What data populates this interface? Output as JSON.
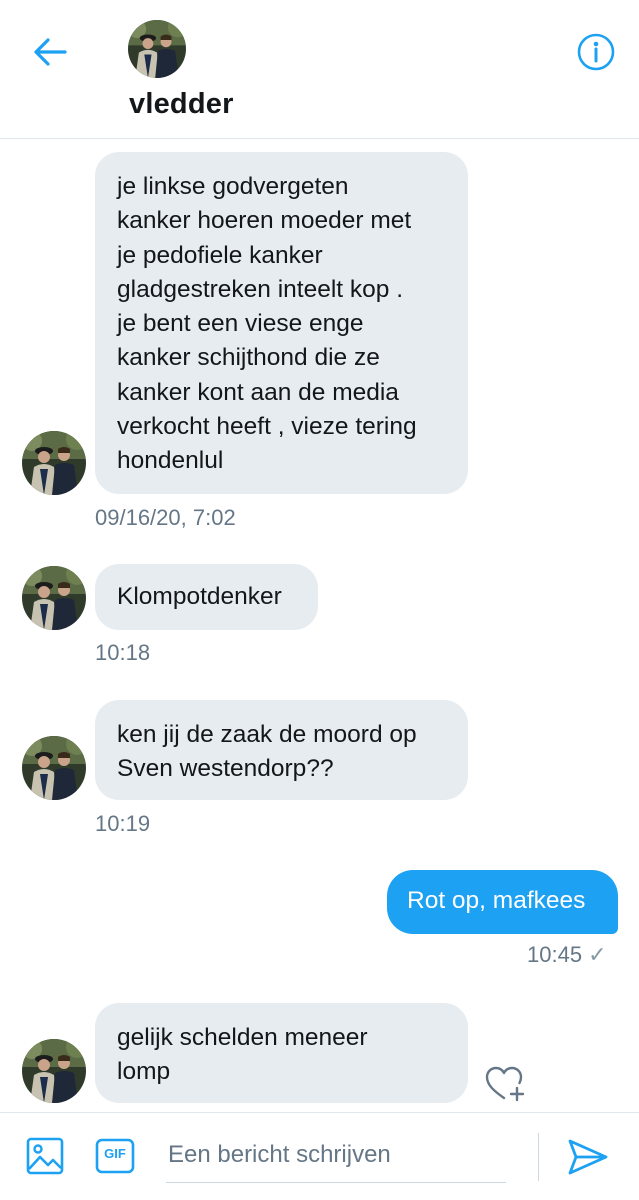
{
  "header": {
    "username": "vledder"
  },
  "messages": [
    {
      "direction": "incoming",
      "text": "je linkse godvergeten\nkanker hoeren moeder met\nje pedofiele kanker\ngladgestreken inteelt kop .\nje bent een viese enge\nkanker schijthond die ze\nkanker kont aan de media\nverkocht heeft , vieze tering\nhondenlul",
      "time": "09/16/20, 7:02"
    },
    {
      "direction": "incoming",
      "text": "Klompotdenker",
      "time": "10:18"
    },
    {
      "direction": "incoming",
      "text": "ken jij de zaak de moord op\nSven westendorp??",
      "time": "10:19"
    },
    {
      "direction": "outgoing",
      "text": "Rot op, mafkees",
      "time": "10:45",
      "status": "✓"
    },
    {
      "direction": "incoming",
      "text": "gelijk schelden meneer\nlomp",
      "time": ""
    }
  ],
  "composer": {
    "placeholder": "Een bericht schrijven",
    "gif_label": "GIF"
  },
  "colors": {
    "accent": "#1da1f2",
    "incoming_bubble": "#e6ecf0",
    "text_secondary": "#657786"
  },
  "icons": {
    "back": "arrow-left-icon",
    "info": "info-icon",
    "media": "image-icon",
    "gif": "gif-icon",
    "send": "send-icon",
    "react": "heart-plus-icon"
  }
}
